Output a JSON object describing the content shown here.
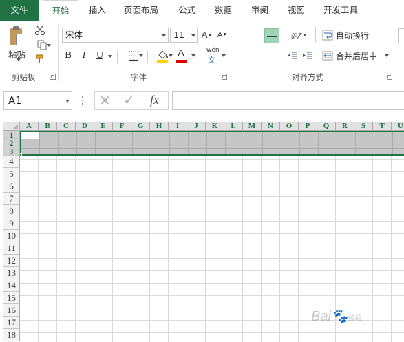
{
  "tabs": [
    "文件",
    "开始",
    "插入",
    "页面布局",
    "公式",
    "数据",
    "审阅",
    "视图",
    "开发工具"
  ],
  "ribbon": {
    "clipboard": {
      "paste": "粘贴",
      "group_label": "剪贴板"
    },
    "font": {
      "font_name": "宋体",
      "font_size": "11",
      "bold": "B",
      "italic": "I",
      "underline": "U",
      "grow": "A",
      "shrink": "A",
      "font_color_letter": "A",
      "phonetic_top": "wén",
      "phonetic_bottom": "文",
      "group_label": "字体"
    },
    "alignment": {
      "wrap_text": "自动换行",
      "merge_center": "合并后居中",
      "group_label": "对齐方式"
    },
    "colors": {
      "accent": "#217346",
      "fill_yellow": "#ffd200",
      "font_red": "#e00000"
    }
  },
  "formula_bar": {
    "name_box": "A1",
    "fx": "fx",
    "cancel": "✕",
    "enter": "✓"
  },
  "grid": {
    "columns": [
      "A",
      "B",
      "C",
      "D",
      "E",
      "F",
      "G",
      "H",
      "I",
      "J",
      "K",
      "L",
      "M",
      "N",
      "O",
      "P",
      "Q",
      "R",
      "S",
      "T",
      "U"
    ],
    "rows": [
      "1",
      "2",
      "3",
      "4",
      "5",
      "6",
      "7",
      "8",
      "9",
      "10",
      "11",
      "12",
      "13",
      "14",
      "15",
      "16",
      "17",
      "18"
    ],
    "selected_rows": [
      "1",
      "2",
      "3"
    ]
  },
  "watermark": {
    "text": "Bai",
    "suffix": "经验"
  }
}
